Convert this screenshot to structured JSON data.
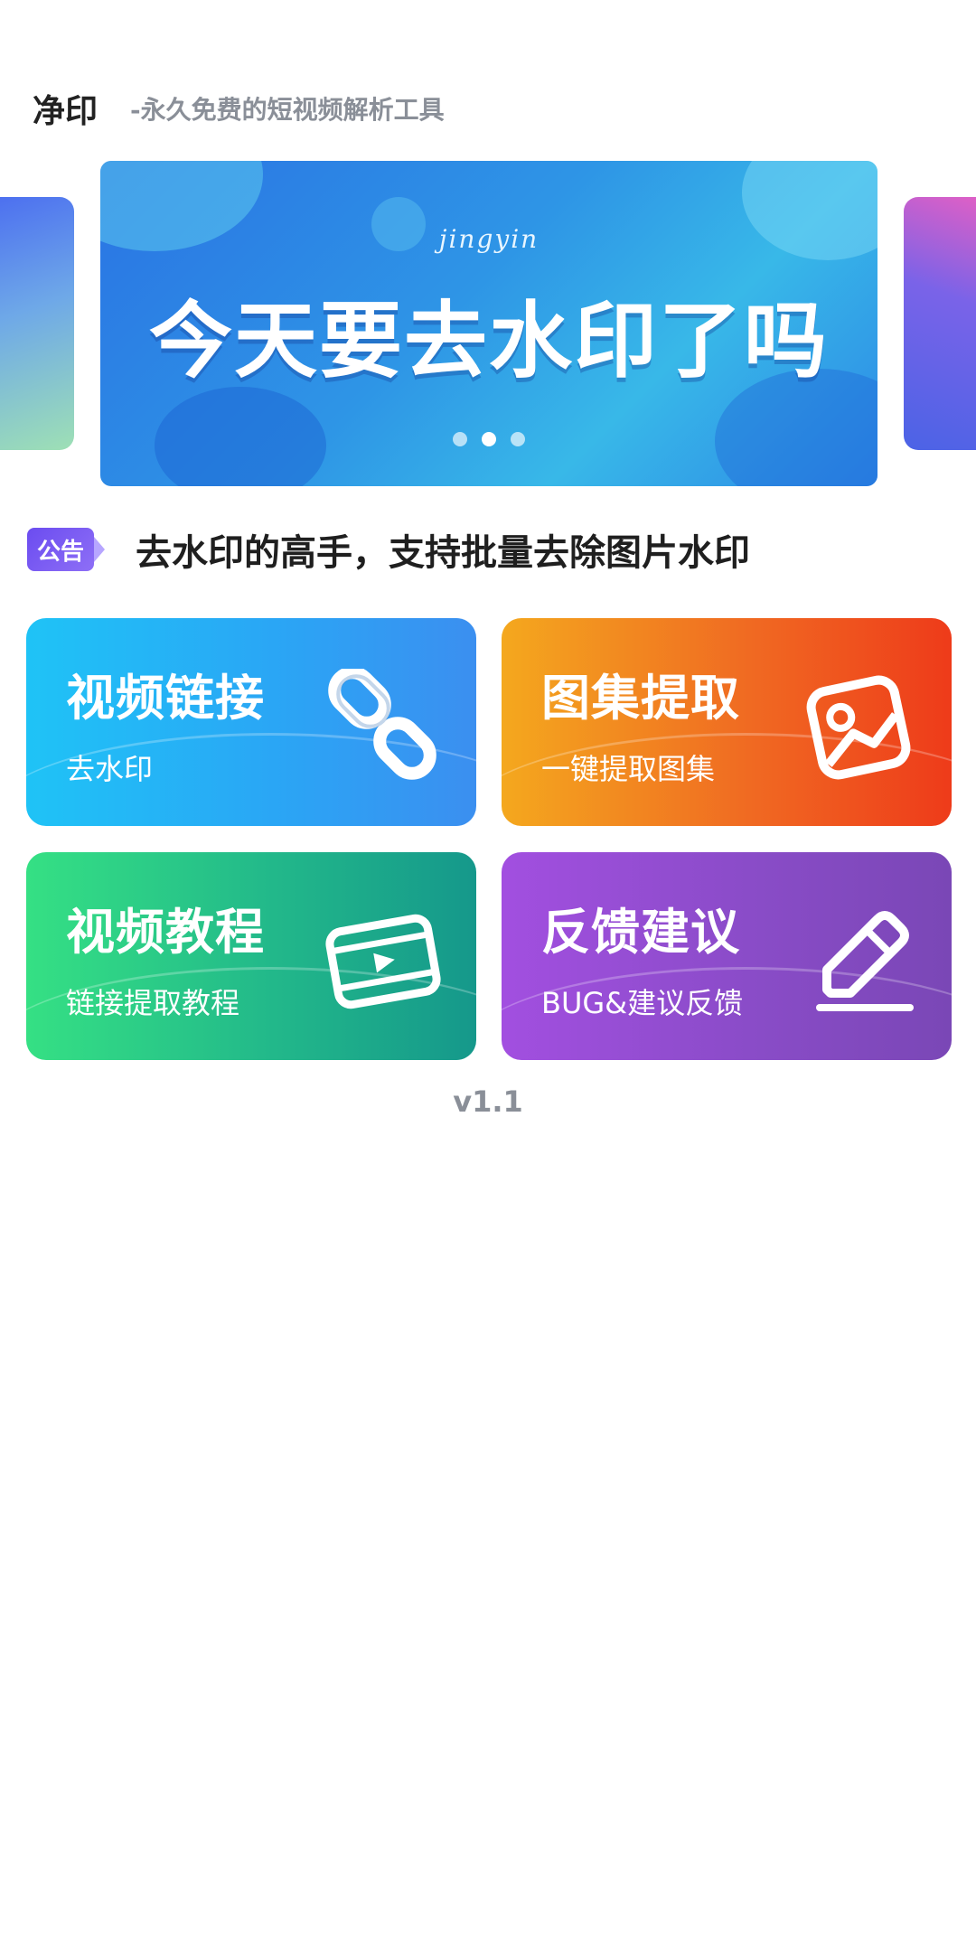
{
  "header": {
    "app_name": "净印",
    "tagline": "-永久免费的短视频解析工具"
  },
  "banner": {
    "subtitle": "jingyin",
    "title": "今天要去水印了吗",
    "dots": 3,
    "active_dot": 1
  },
  "notice": {
    "badge": "公告",
    "text": "去水印的高手，支持批量去除图片水印"
  },
  "cards": {
    "video_link": {
      "title": "视频链接",
      "subtitle": "去水印",
      "icon": "link-icon"
    },
    "gallery": {
      "title": "图集提取",
      "subtitle": "一键提取图集",
      "icon": "image-icon"
    },
    "tutorial": {
      "title": "视频教程",
      "subtitle": "链接提取教程",
      "icon": "video-play-icon"
    },
    "feedback": {
      "title": "反馈建议",
      "subtitle": "BUG&建议反馈",
      "icon": "pen-icon"
    }
  },
  "footer": {
    "version": "v1.1"
  },
  "colors": {
    "banner": "#2e95e6",
    "video_link": "#2aa6f5",
    "gallery": "#f06a22",
    "tutorial": "#22b88a",
    "feedback": "#8a4cc8",
    "notice_badge": "#6b4cf0"
  }
}
